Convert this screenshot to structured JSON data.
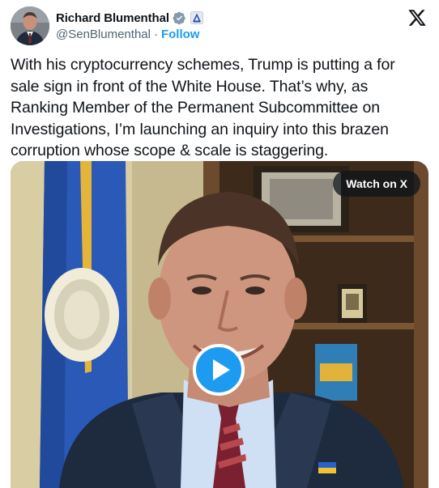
{
  "author": {
    "display_name": "Richard Blumenthal",
    "handle": "@SenBlumenthal",
    "separator": "·",
    "follow_label": "Follow",
    "verified_color": "#829aab"
  },
  "tweet": {
    "text": "With his cryptocurrency schemes, Trump is putting a for sale sign in front of the White House. That’s why, as Ranking Member of the Permanent Subcommittee on Investigations, I’m launching an inquiry into this brazen corruption whose scope & scale is staggering."
  },
  "media": {
    "type": "video",
    "watch_label": "Watch on X",
    "play_icon": "play-icon"
  },
  "colors": {
    "accent": "#1d9bf0",
    "text": "#0f1419",
    "secondary": "#536471"
  },
  "icons": [
    "verified-badge-icon",
    "government-label-icon",
    "x-logo-icon",
    "play-icon"
  ]
}
